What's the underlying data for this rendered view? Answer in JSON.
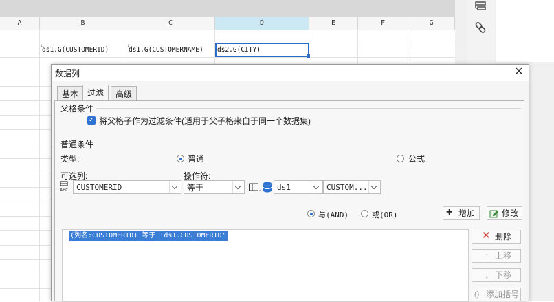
{
  "sheet": {
    "columns": [
      "A",
      "B",
      "C",
      "D",
      "E",
      "F",
      "G"
    ],
    "cells": {
      "b2": "ds1.G(CUSTOMERID)",
      "c2": "ds1.G(CUSTOMERNAME)",
      "d2": "ds2.G(CITY)"
    }
  },
  "dialog": {
    "title": "数据列",
    "tabs": [
      "基本",
      "过滤",
      "高级"
    ],
    "parent": {
      "section": "父格条件",
      "checkbox_label": "将父格子作为过滤条件(适用于父子格来自于同一个数据集)"
    },
    "normal": {
      "section": "普通条件",
      "type_label": "类型:",
      "radio_normal": "普通",
      "radio_formula": "公式",
      "column_label": "可选列:",
      "operator_label": "操作符:",
      "column_value": "CUSTOMERID",
      "operator_value": "等于",
      "dataset_value": "ds1",
      "field_value": "CUSTOM..."
    },
    "logic": {
      "and": "与(AND)",
      "or": "或(OR)",
      "add": "增加",
      "edit": "修改"
    },
    "conditions": [
      "(列名:CUSTOMERID) 等于 'ds1.CUSTOMERID'"
    ],
    "side_buttons": {
      "delete": "删除",
      "up": "上移",
      "down": "下移",
      "add_bracket": "添加括号"
    }
  },
  "colors": {
    "accent": "#2f73d2",
    "selection": "#3b7ed6",
    "delete_red": "#d23a2e"
  }
}
